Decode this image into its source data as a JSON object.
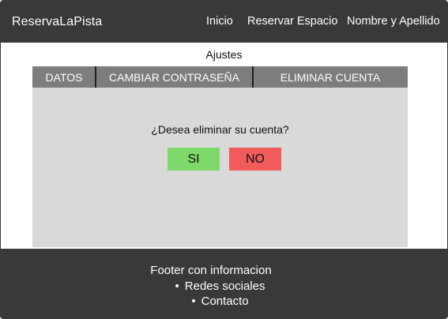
{
  "navbar": {
    "brand": "ReservaLaPista",
    "links": [
      "Inicio",
      "Reservar Espacio",
      "Nombre y Apellido"
    ]
  },
  "page": {
    "title": "Ajustes"
  },
  "tabs": [
    "DATOS",
    "CAMBIAR CONTRASEÑA",
    "ELIMINAR CUENTA"
  ],
  "dialog": {
    "question": "¿Desea eliminar su cuenta?",
    "yes_label": "SI",
    "no_label": "NO"
  },
  "footer": {
    "title": "Footer con informacion",
    "items": [
      "Redes sociales",
      "Contacto"
    ]
  },
  "colors": {
    "dark": "#3a3838",
    "tab_bar": "#7f7c7d",
    "panel": "#d9d9d9",
    "yes": "#7ed86a",
    "no": "#f25b5b"
  }
}
